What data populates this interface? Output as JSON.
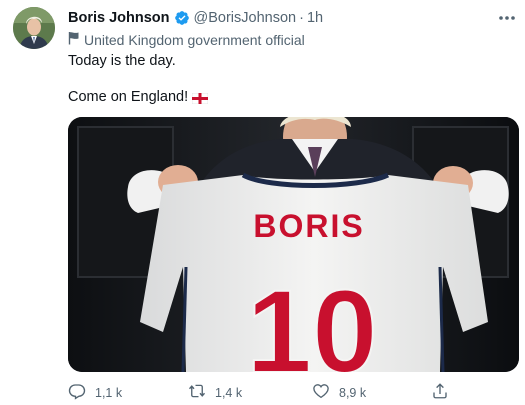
{
  "author": {
    "name": "Boris Johnson",
    "handle": "@BorisJohnson",
    "separator": "·",
    "time": "1h",
    "label": "United Kingdom government official",
    "verified_icon": "verified-badge-icon",
    "label_icon": "flag-outline-icon"
  },
  "tweet": {
    "line1": "Today is the day.",
    "line2": "Come on England!",
    "emoji": "england-flag"
  },
  "media": {
    "shirt_name": "BORIS",
    "shirt_number": "10"
  },
  "actions": {
    "replies": "1,1 k",
    "retweets": "1,4 k",
    "likes": "8,9 k"
  },
  "colors": {
    "text": "#0f1419",
    "secondary": "#536471",
    "verified": "#1d9bf0",
    "shirt_red": "#c8102e"
  }
}
